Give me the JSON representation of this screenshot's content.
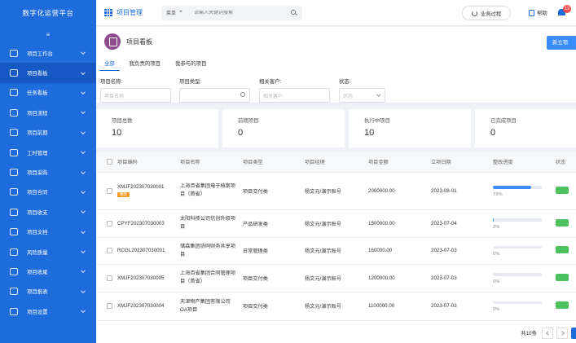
{
  "brand": "数字化运营平台",
  "sidebar": {
    "collapse_icon": "menu-fold-icon",
    "items": [
      {
        "label": "项目工作台",
        "icon": "monitor-icon",
        "active": false
      },
      {
        "label": "项目看板",
        "icon": "dashboard-icon",
        "active": true
      },
      {
        "label": "任务看板",
        "icon": "task-icon",
        "active": false
      },
      {
        "label": "项目流程",
        "icon": "flow-icon",
        "active": false
      },
      {
        "label": "项目前期",
        "icon": "document-icon",
        "active": false
      },
      {
        "label": "工时管理",
        "icon": "clock-sheet-icon",
        "active": false
      },
      {
        "label": "项目采购",
        "icon": "cart-icon",
        "active": false
      },
      {
        "label": "项目合同",
        "icon": "contract-icon",
        "active": false
      },
      {
        "label": "项目收支",
        "icon": "wallet-icon",
        "active": false
      },
      {
        "label": "项目文档",
        "icon": "file-icon",
        "active": false
      },
      {
        "label": "风险质量",
        "icon": "shield-icon",
        "active": false
      },
      {
        "label": "项目收尾",
        "icon": "flag-icon",
        "active": false
      },
      {
        "label": "项目报表",
        "icon": "report-icon",
        "active": false
      },
      {
        "label": "项目设置",
        "icon": "gear-icon",
        "active": false
      }
    ]
  },
  "topbar": {
    "app_title": "项目管理",
    "search_scope": "菜单",
    "search_placeholder": "请输入关键词搜索",
    "biz_process_label": "业务过程",
    "help_label": "帮助",
    "notification_count": "12"
  },
  "page": {
    "title": "项目看板",
    "new_button": "新立项",
    "tabs": [
      "全部",
      "我负责的项目",
      "我参与的项目"
    ],
    "active_tab": 0
  },
  "filters": {
    "name_label": "项目名称:",
    "name_placeholder": "项目名称",
    "type_label": "项目类型:",
    "customer_label": "相关客户:",
    "customer_placeholder": "相关客户",
    "status_label": "状态:",
    "status_placeholder": "状态"
  },
  "stats": [
    {
      "label": "项目总数",
      "value": "10"
    },
    {
      "label": "前期项目",
      "value": "0"
    },
    {
      "label": "执行中项目",
      "value": "10"
    },
    {
      "label": "已完成项目",
      "value": "0"
    }
  ],
  "table": {
    "columns": [
      "项目编码",
      "项目名称",
      "项目类型",
      "项目经理",
      "项目金额",
      "立项日期",
      "整改进度",
      "状态"
    ],
    "rows": [
      {
        "code": "XMJF202307030001",
        "tag": "整改",
        "name": "上海百省集团电子档案项目（首省）",
        "type": "项目交付类",
        "manager": "杨文元/演示账号",
        "amount": "2000000.00",
        "date": "2023-08-01",
        "progress": 79,
        "progress_text": "79%"
      },
      {
        "code": "CPYF202307030003",
        "tag": "",
        "name": "太阳科技公司信创升级项目",
        "type": "产品研发类",
        "manager": "杨文元/演示账号",
        "amount": "1500000.00",
        "date": "2023-07-04",
        "progress": 2,
        "progress_text": "2%"
      },
      {
        "code": "RCGL202307030001",
        "tag": "",
        "name": "储森集团协同财务共享项目",
        "type": "日常管理类",
        "manager": "杨文元/演示账号",
        "amount": "160000.00",
        "date": "2023-07-03",
        "progress": 0,
        "progress_text": "0%"
      },
      {
        "code": "XMJF202307030005",
        "tag": "",
        "name": "上海百省集团合同管理项目（首省）",
        "type": "项目交付类",
        "manager": "杨文元/演示账号",
        "amount": "1200000.00",
        "date": "2023-07-03",
        "progress": 0,
        "progress_text": "0%"
      },
      {
        "code": "XMJF202307030004",
        "tag": "",
        "name": "天津物产集团有限公司OA项目",
        "type": "项目交付类",
        "manager": "杨文元/演示账号",
        "amount": "1100000.00",
        "date": "2023-07-03",
        "progress": 0,
        "progress_text": "0%"
      }
    ]
  },
  "pagination": {
    "total": "共10条"
  },
  "colors": {
    "primary": "#1e6bdc",
    "accent_button": "#3a8cff",
    "tag": "#f59a23",
    "status_green": "#4cc15f",
    "badge": "#f24b4b"
  }
}
